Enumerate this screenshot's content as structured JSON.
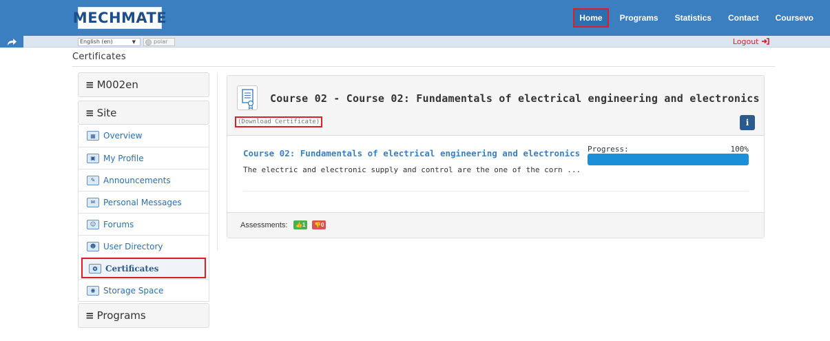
{
  "header": {
    "logo_text": "MECHMATE",
    "nav": [
      {
        "label": "Home",
        "active": true
      },
      {
        "label": "Programs",
        "active": false
      },
      {
        "label": "Statistics",
        "active": false
      },
      {
        "label": "Contact",
        "active": false
      },
      {
        "label": "Coursevo",
        "active": false
      }
    ]
  },
  "subbar": {
    "language": "English (en)",
    "theme": "polar",
    "logout": "Logout"
  },
  "page": {
    "title": "Certificates"
  },
  "sidebar": {
    "course_header": "M002en",
    "site_header": "Site",
    "items": [
      {
        "label": "Overview",
        "icon": "overview-icon",
        "active": false
      },
      {
        "label": "My Profile",
        "icon": "profile-icon",
        "active": false
      },
      {
        "label": "Announcements",
        "icon": "announcements-icon",
        "active": false
      },
      {
        "label": "Personal Messages",
        "icon": "messages-icon",
        "active": false
      },
      {
        "label": "Forums",
        "icon": "forums-icon",
        "active": false
      },
      {
        "label": "User Directory",
        "icon": "directory-icon",
        "active": false
      },
      {
        "label": "Certificates",
        "icon": "certificate-icon",
        "active": true
      },
      {
        "label": "Storage Space",
        "icon": "storage-icon",
        "active": false
      }
    ],
    "programs_header": "Programs"
  },
  "certificate": {
    "title": "Course 02 - Course 02: Fundamentals of electrical engineering and electronics",
    "download_label": "(Download Certificate)",
    "info_label": "i",
    "course_link": "Course 02: Fundamentals of electrical engineering and electronics",
    "description": "The electric and electronic supply and control are the one of the corn ...",
    "progress_label": "Progress:",
    "progress_value": "100%",
    "progress_fraction": 1.0,
    "assessments_label": "Assessments:",
    "positive_count": "1",
    "negative_count": "0"
  },
  "colors": {
    "nav_bg": "#3b7fc0",
    "highlight": "#e01c24",
    "progress": "#1b8fd8",
    "link": "#3b7fc0"
  }
}
